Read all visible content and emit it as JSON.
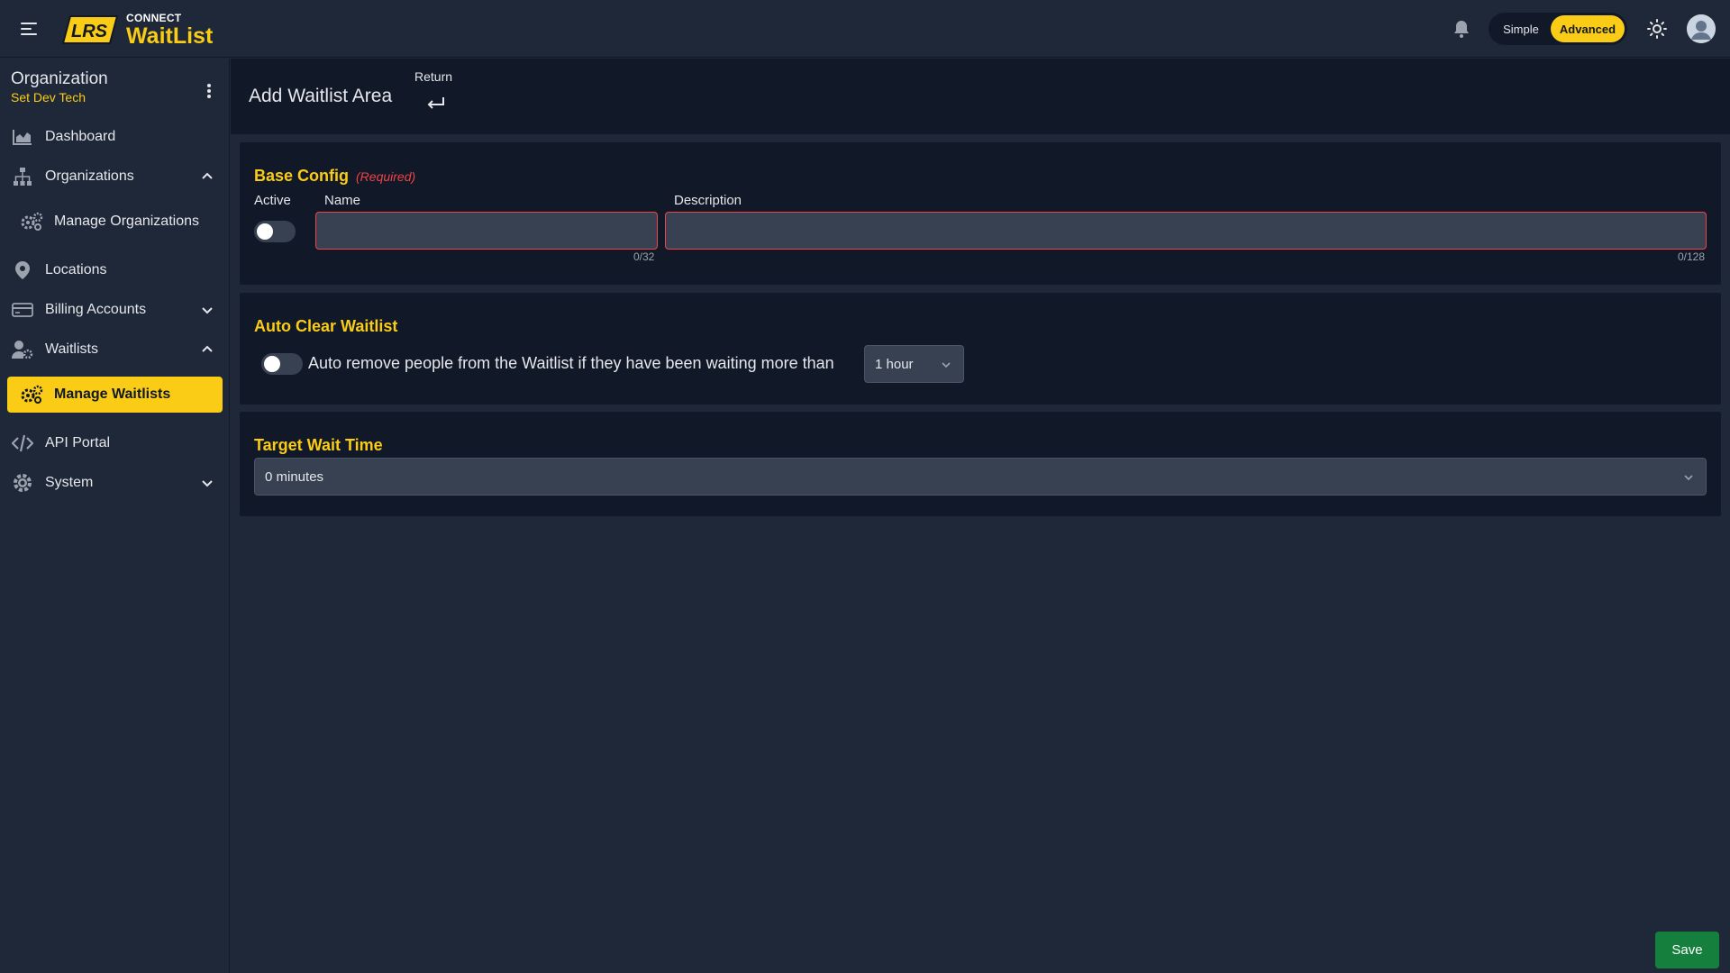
{
  "brand": {
    "logo_text": "LRS",
    "product_prefix": "CONNECT",
    "product_name": "WaitList",
    "accent": "#facc15"
  },
  "header": {
    "mode_simple": "Simple",
    "mode_advanced": "Advanced",
    "mode_selected": "Advanced",
    "icons": [
      "menu-icon",
      "bell-icon",
      "sun-icon",
      "user-avatar-icon"
    ]
  },
  "sidebar": {
    "org_title": "Organization",
    "org_name": "Set Dev Tech",
    "items": [
      {
        "label": "Dashboard",
        "icon": "chart-area-icon"
      },
      {
        "label": "Organizations",
        "icon": "sitemap-icon",
        "expanded": true
      },
      {
        "label": "Manage Organizations",
        "icon": "gears-icon",
        "sub": true
      },
      {
        "label": "Locations",
        "icon": "map-pin-icon"
      },
      {
        "label": "Billing Accounts",
        "icon": "credit-card-icon",
        "expanded": false
      },
      {
        "label": "Waitlists",
        "icon": "user-gear-icon",
        "expanded": true
      },
      {
        "label": "Manage Waitlists",
        "icon": "gears-icon",
        "sub": true,
        "active": true
      },
      {
        "label": "API Portal",
        "icon": "code-icon"
      },
      {
        "label": "System",
        "icon": "gear-icon",
        "expanded": false
      }
    ]
  },
  "page": {
    "title": "Add Waitlist Area",
    "return_label": "Return"
  },
  "base_config": {
    "title": "Base Config",
    "required_tag": "(Required)",
    "active_label": "Active",
    "active_on": false,
    "name_label": "Name",
    "name_value": "",
    "name_counter": "0/32",
    "description_label": "Description",
    "description_value": "",
    "description_counter": "0/128"
  },
  "auto_clear": {
    "title": "Auto Clear Waitlist",
    "enabled": false,
    "text": "Auto remove people from the Waitlist if they have been waiting more than",
    "duration_value": "1 hour"
  },
  "target_wait": {
    "title": "Target Wait Time",
    "value": "0 minutes"
  },
  "actions": {
    "save_label": "Save",
    "save_color": "#15803d"
  }
}
